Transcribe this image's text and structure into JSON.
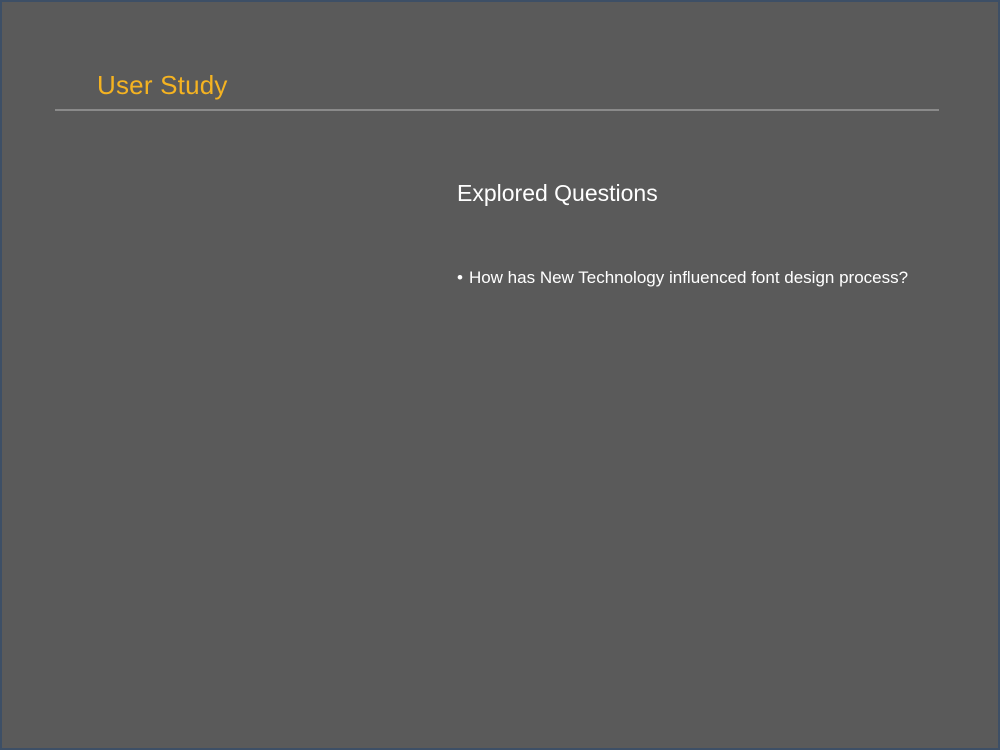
{
  "slide": {
    "title": "User Study",
    "subheading": "Explored Questions",
    "bullet_symbol": "•",
    "bullets": [
      "How has New Technology influenced font design process?"
    ]
  },
  "colors": {
    "background": "#5a5a5a",
    "title": "#f5b321",
    "text": "#ffffff",
    "divider": "#8a8a8a",
    "frame": "#3d4f66"
  }
}
